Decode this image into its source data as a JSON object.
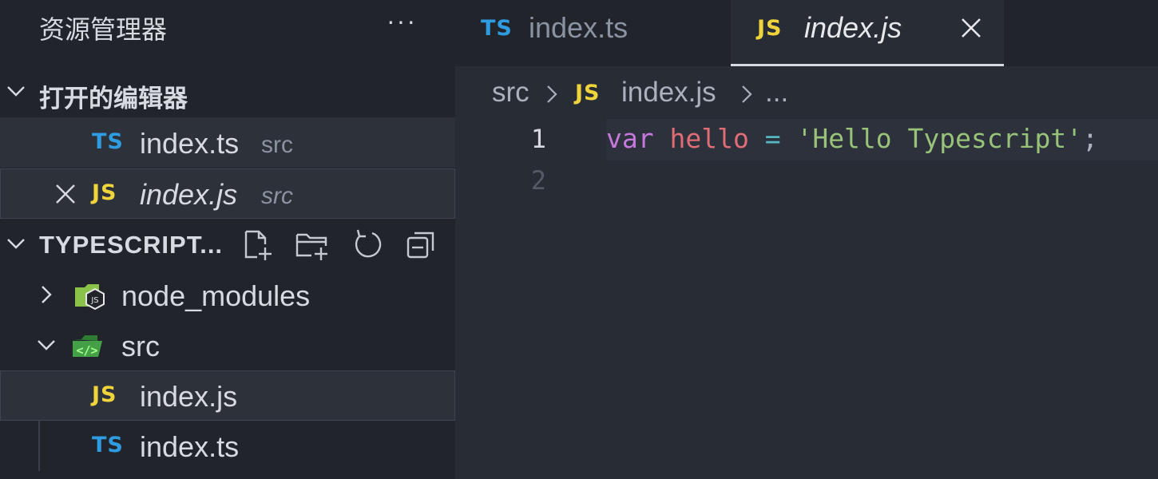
{
  "explorer": {
    "title": "资源管理器",
    "more": "···",
    "open_editors": {
      "label": "打开的编辑器",
      "items": [
        {
          "badge": "TS",
          "name": "index.ts",
          "dir": "src"
        },
        {
          "badge": "JS",
          "name": "index.js",
          "dir": "src"
        }
      ]
    },
    "project": {
      "label": "TYPESCRIPT...",
      "actions": [
        "new-file-icon",
        "new-folder-icon",
        "refresh-icon",
        "collapse-all-icon"
      ],
      "tree": {
        "node_modules": "node_modules",
        "src": "src",
        "files": [
          {
            "badge": "JS",
            "name": "index.js"
          },
          {
            "badge": "TS",
            "name": "index.ts"
          }
        ]
      }
    }
  },
  "tabs": [
    {
      "badge": "TS",
      "name": "index.ts",
      "active": false
    },
    {
      "badge": "JS",
      "name": "index.js",
      "active": true
    }
  ],
  "breadcrumb": {
    "folder": "src",
    "badge": "JS",
    "file": "index.js",
    "more": "..."
  },
  "code": {
    "lines": [
      {
        "number": "1",
        "tokens": {
          "kw": "var",
          "name": "hello",
          "op": "=",
          "str": "'Hello Typescript'",
          "punc": ";"
        }
      },
      {
        "number": "2"
      }
    ]
  },
  "colors": {
    "ts_badge": "#2f9be0",
    "js_badge": "#f0d43c",
    "sidebar_bg": "#21252b",
    "editor_bg": "#282c34",
    "node_folder": "#8bc34a",
    "src_folder": "#4caf50"
  }
}
